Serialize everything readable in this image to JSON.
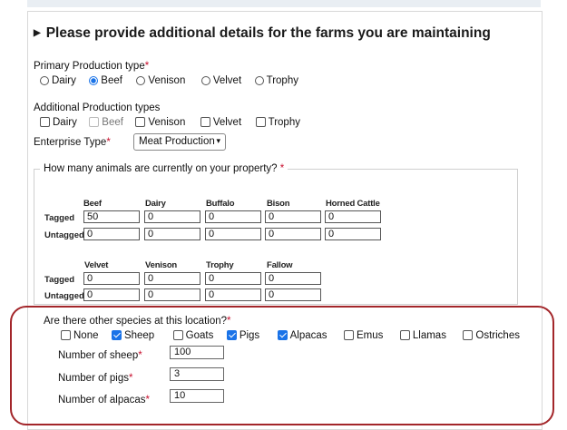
{
  "title": "Please provide additional details for the farms you are maintaining",
  "primary": {
    "label": "Primary Production type",
    "required": "*",
    "options": [
      "Dairy",
      "Beef",
      "Venison",
      "Velvet",
      "Trophy"
    ],
    "selected": "Beef"
  },
  "additional": {
    "label": "Additional Production types",
    "options": [
      "Dairy",
      "Beef",
      "Venison",
      "Velvet",
      "Trophy"
    ]
  },
  "enterprise": {
    "label": "Enterprise Type",
    "required": "*",
    "value": "Meat Production"
  },
  "animals": {
    "legend": "How many animals are currently on your property?",
    "required": "*",
    "row_tagged": "Tagged",
    "row_untagged": "Untagged",
    "group1": {
      "columns": [
        "Beef",
        "Dairy",
        "Buffalo",
        "Bison",
        "Horned Cattle"
      ],
      "tagged": [
        "50",
        "0",
        "0",
        "0",
        "0"
      ],
      "untagged": [
        "0",
        "0",
        "0",
        "0",
        "0"
      ]
    },
    "group2": {
      "columns": [
        "Velvet",
        "Venison",
        "Trophy",
        "Fallow"
      ],
      "tagged": [
        "0",
        "0",
        "0",
        "0"
      ],
      "untagged": [
        "0",
        "0",
        "0",
        "0"
      ]
    }
  },
  "species": {
    "label": "Are there other species at this location?",
    "required": "*",
    "options": [
      "None",
      "Sheep",
      "Goats",
      "Pigs",
      "Alpacas",
      "Emus",
      "Llamas",
      "Ostriches"
    ],
    "checked": [
      "Sheep",
      "Pigs",
      "Alpacas"
    ],
    "sheep_label": "Number of sheep",
    "sheep_value": "100",
    "pigs_label": "Number of pigs",
    "pigs_value": "3",
    "alpacas_label": "Number of alpacas",
    "alpacas_value": "10"
  },
  "colors": {
    "accent": "#1a73e8",
    "required": "#c8102e",
    "highlight": "#a3262a"
  }
}
